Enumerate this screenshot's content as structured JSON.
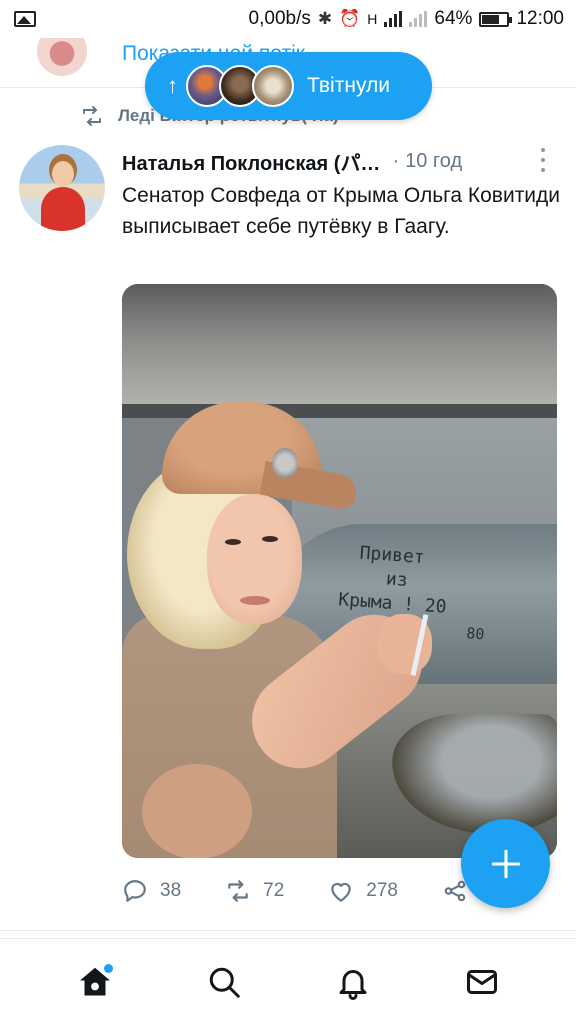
{
  "status_bar": {
    "speed": "0,00b/s",
    "network_h": "H",
    "battery": "64%",
    "time": "12:00"
  },
  "top_row": {
    "show_thread": "Показати цей потік"
  },
  "new_tweets_pill": {
    "label": "Твітнули"
  },
  "retweet_context": {
    "text": "Леді Вінтер ретвітнув(-ла)"
  },
  "tweet": {
    "author_name": "Наталья Поклонская (パ…",
    "time": "10 год",
    "text": "Сенатор Совфеда от Крыма Ольга Ковитиди выписывает себе путёвку в Гаагу.",
    "image_text": [
      "Привет",
      "из",
      "Крыма ! 20",
      "80"
    ],
    "replies": "38",
    "retweets": "72",
    "likes": "278"
  },
  "colors": {
    "accent": "#1da1f2",
    "secondary_text": "#657786"
  },
  "icons": {
    "home": "home-icon",
    "search": "search-icon",
    "notifications": "bell-icon",
    "messages": "mail-icon",
    "compose": "plus-icon"
  }
}
